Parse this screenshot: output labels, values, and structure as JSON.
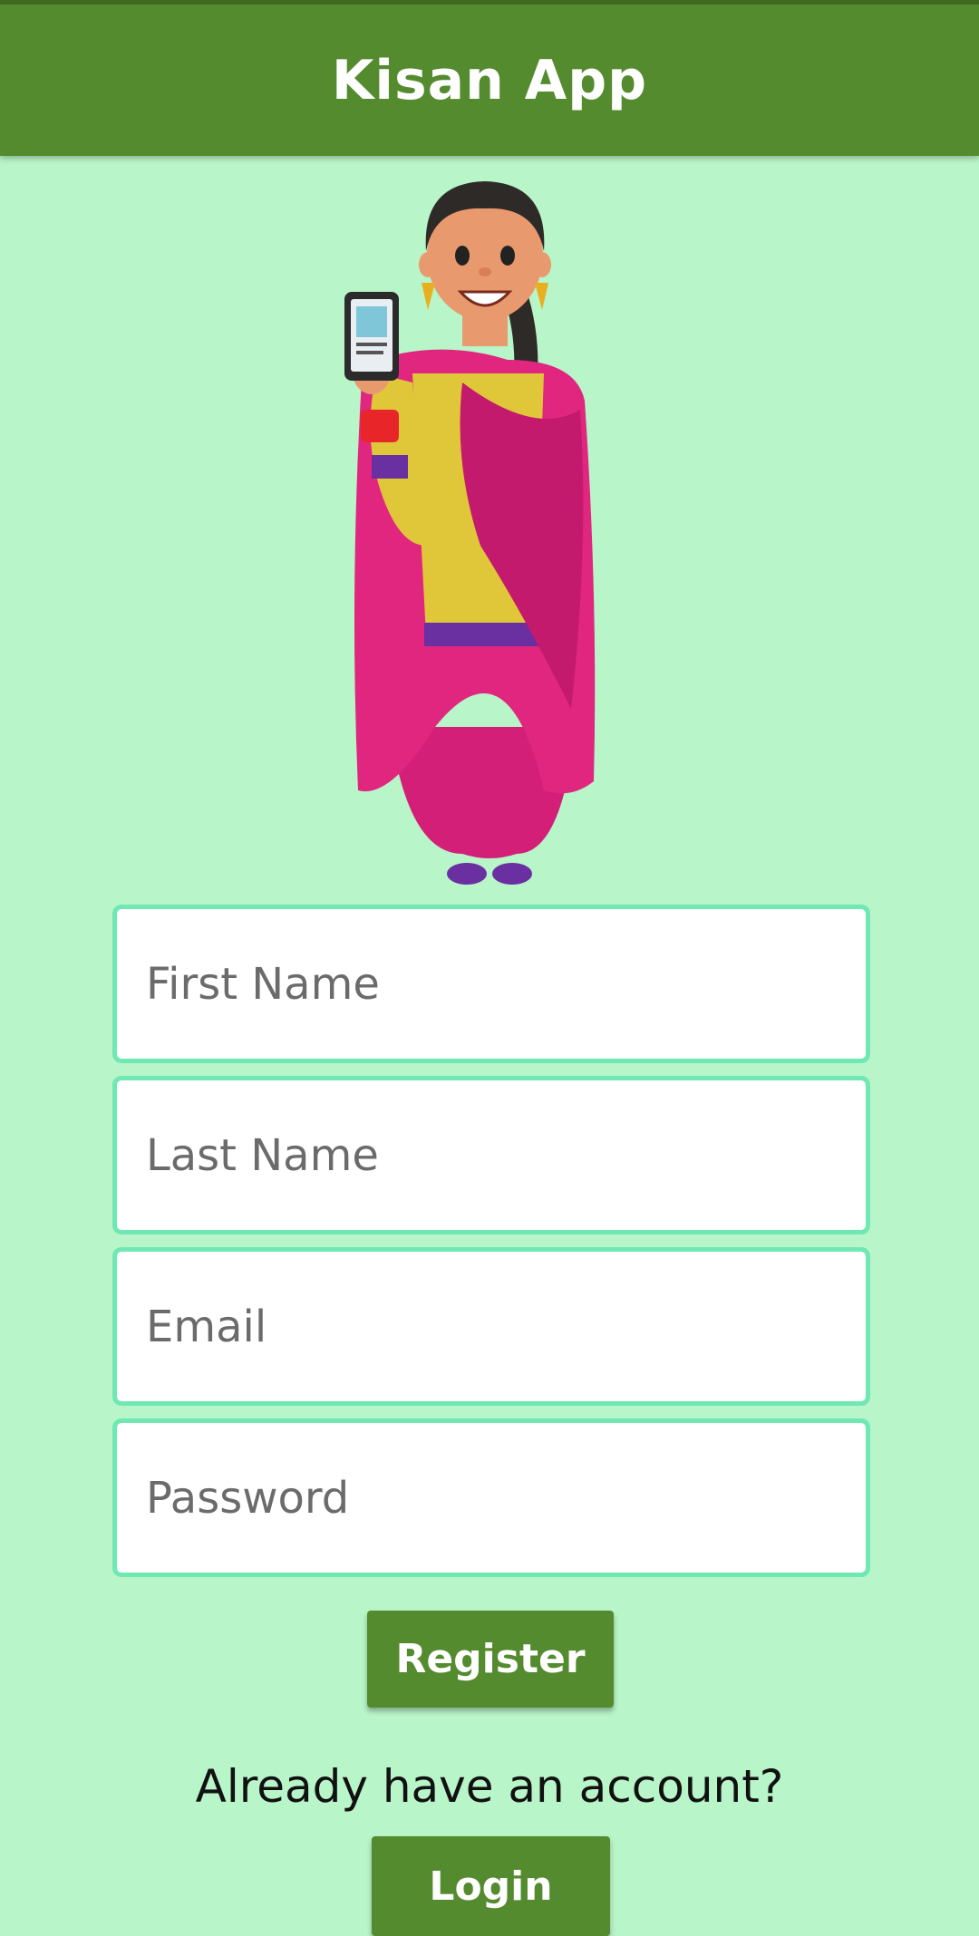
{
  "header": {
    "title": "Kisan App"
  },
  "form": {
    "first_name_placeholder": "First Name",
    "last_name_placeholder": "Last Name",
    "email_placeholder": "Email",
    "password_placeholder": "Password",
    "register_label": "Register"
  },
  "footer": {
    "prompt": "Already have an account?",
    "login_label": "Login"
  },
  "colors": {
    "background": "#b8f5c9",
    "app_bar": "#548b2e",
    "field_border": "#6fe8b2",
    "button": "#548b2e"
  }
}
